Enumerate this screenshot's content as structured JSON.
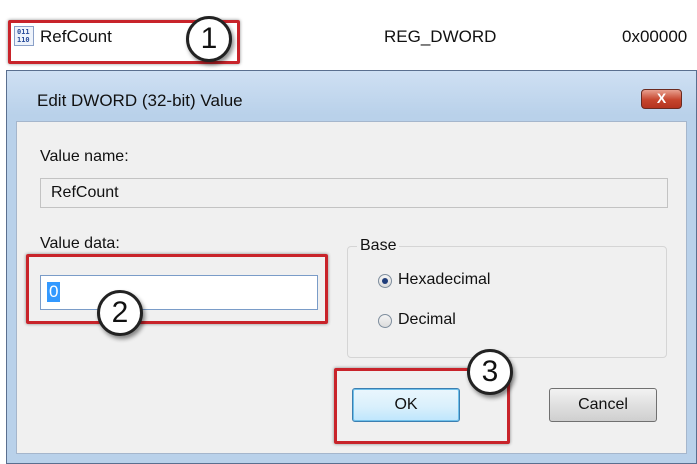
{
  "registry": {
    "partial_row": {
      "name": "",
      "type": "",
      "data": ""
    },
    "row": {
      "name": "RefCount",
      "type": "REG_DWORD",
      "data": "0x00000"
    }
  },
  "dialog": {
    "title": "Edit DWORD (32-bit) Value",
    "close_label": "X",
    "value_name_label": "Value name:",
    "value_name": "RefCount",
    "value_data_label": "Value data:",
    "value_data": "0",
    "base": {
      "label": "Base",
      "options": [
        {
          "label": "Hexadecimal",
          "selected": true
        },
        {
          "label": "Decimal",
          "selected": false
        }
      ]
    },
    "ok_label": "OK",
    "cancel_label": "Cancel"
  },
  "callouts": [
    "1",
    "2",
    "3"
  ],
  "colors": {
    "highlight": "#c8232a",
    "dialog_frame": "#b9d1ea",
    "close_button": "#c6452d"
  },
  "icons": {
    "registry_value": "binary-value-icon",
    "close": "close-icon"
  }
}
